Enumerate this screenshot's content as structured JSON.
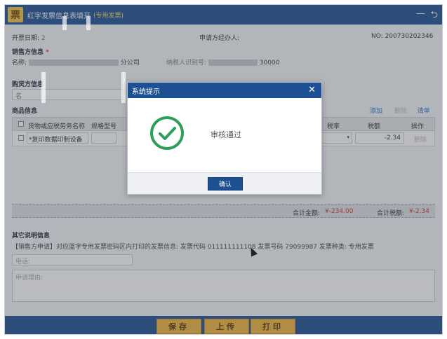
{
  "window": {
    "title": "红字发票信息表填开",
    "title_tag": "(专用发票)",
    "minimize_glyph": "—",
    "back_glyph": "⮌"
  },
  "header": {
    "date_label": "开票日期:",
    "date_value": "2",
    "handler_label": "申请方经办人:",
    "no_label": "NO:",
    "no_value": "200730202346"
  },
  "seller": {
    "section_title": "销售方信息",
    "required_mark": "*",
    "name_label": "名称:",
    "name_suffix": "分公司",
    "tax_id_label": "纳税人识别号:",
    "tax_id_suffix": "30000"
  },
  "buyer": {
    "section_title": "购货方信息",
    "name_label": "名"
  },
  "goods": {
    "section_title": "商品信息",
    "actions": {
      "add": "添加",
      "delete": "删除",
      "clear": "清单"
    },
    "columns": [
      "货物或应税劳务名称",
      "规格型号",
      "税率",
      "税额",
      "操作"
    ],
    "row": {
      "name": "*复印数据印制设备",
      "tax_rate": "",
      "tax_amount": "-2.34",
      "op": "删除"
    },
    "total_amount_label": "合计金额:",
    "total_amount_value": "¥-234.00",
    "total_tax_label": "合计税额:",
    "total_tax_value": "¥-2.34"
  },
  "other": {
    "section_title": "其它说明信息",
    "note": "【销售方申请】对应蓝字专用发票密码区内打印的发票信息: 发票代码 011111111108 发票号码 79099987 发票种类: 专用发票",
    "phone_placeholder": "电话:",
    "reason_placeholder": "申请理由:"
  },
  "footer": {
    "save": "保存",
    "upload": "上传",
    "print": "打印"
  },
  "dialog": {
    "title": "系统提示",
    "close_glyph": "✕",
    "message": "审核通过",
    "ok": "确认"
  },
  "colors": {
    "primary": "#1d4f93",
    "accent_button": "#f0b43c",
    "success": "#2e9f5a",
    "negative": "#d43a2f"
  }
}
